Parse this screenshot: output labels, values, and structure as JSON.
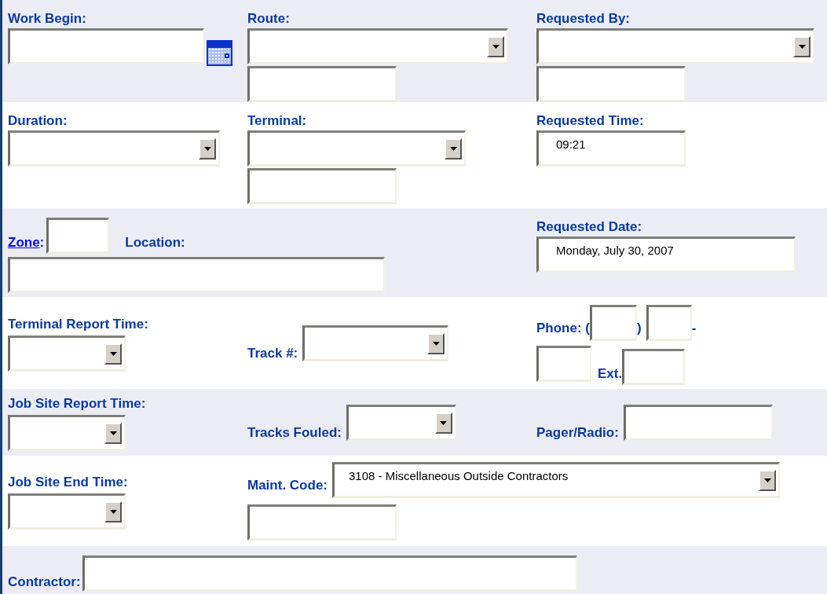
{
  "work_begin": {
    "label": "Work Begin:"
  },
  "route": {
    "label": "Route:"
  },
  "requested_by": {
    "label": "Requested By:"
  },
  "duration": {
    "label": "Duration:"
  },
  "terminal": {
    "label": "Terminal:"
  },
  "requested_time": {
    "label": "Requested Time:",
    "value": "09:21"
  },
  "zone": {
    "label": "Zone",
    "suffix": ":"
  },
  "location": {
    "label": "Location:"
  },
  "requested_date": {
    "label": "Requested Date:",
    "value": "Monday, July 30, 2007"
  },
  "terminal_report_time": {
    "label": "Terminal Report Time:"
  },
  "track": {
    "label": "Track #:"
  },
  "phone": {
    "label": "Phone: (",
    "close": ")",
    "dash": "-",
    "ext": "Ext."
  },
  "job_site_report_time": {
    "label": "Job Site Report Time:"
  },
  "tracks_fouled": {
    "label": "Tracks Fouled:"
  },
  "pager_radio": {
    "label": "Pager/Radio:"
  },
  "job_site_end_time": {
    "label": "Job Site End Time:"
  },
  "maint_code": {
    "label": "Maint. Code:",
    "value": "3108 - Miscellaneous Outside Contractors"
  },
  "contractor": {
    "label": "Contractor:"
  }
}
